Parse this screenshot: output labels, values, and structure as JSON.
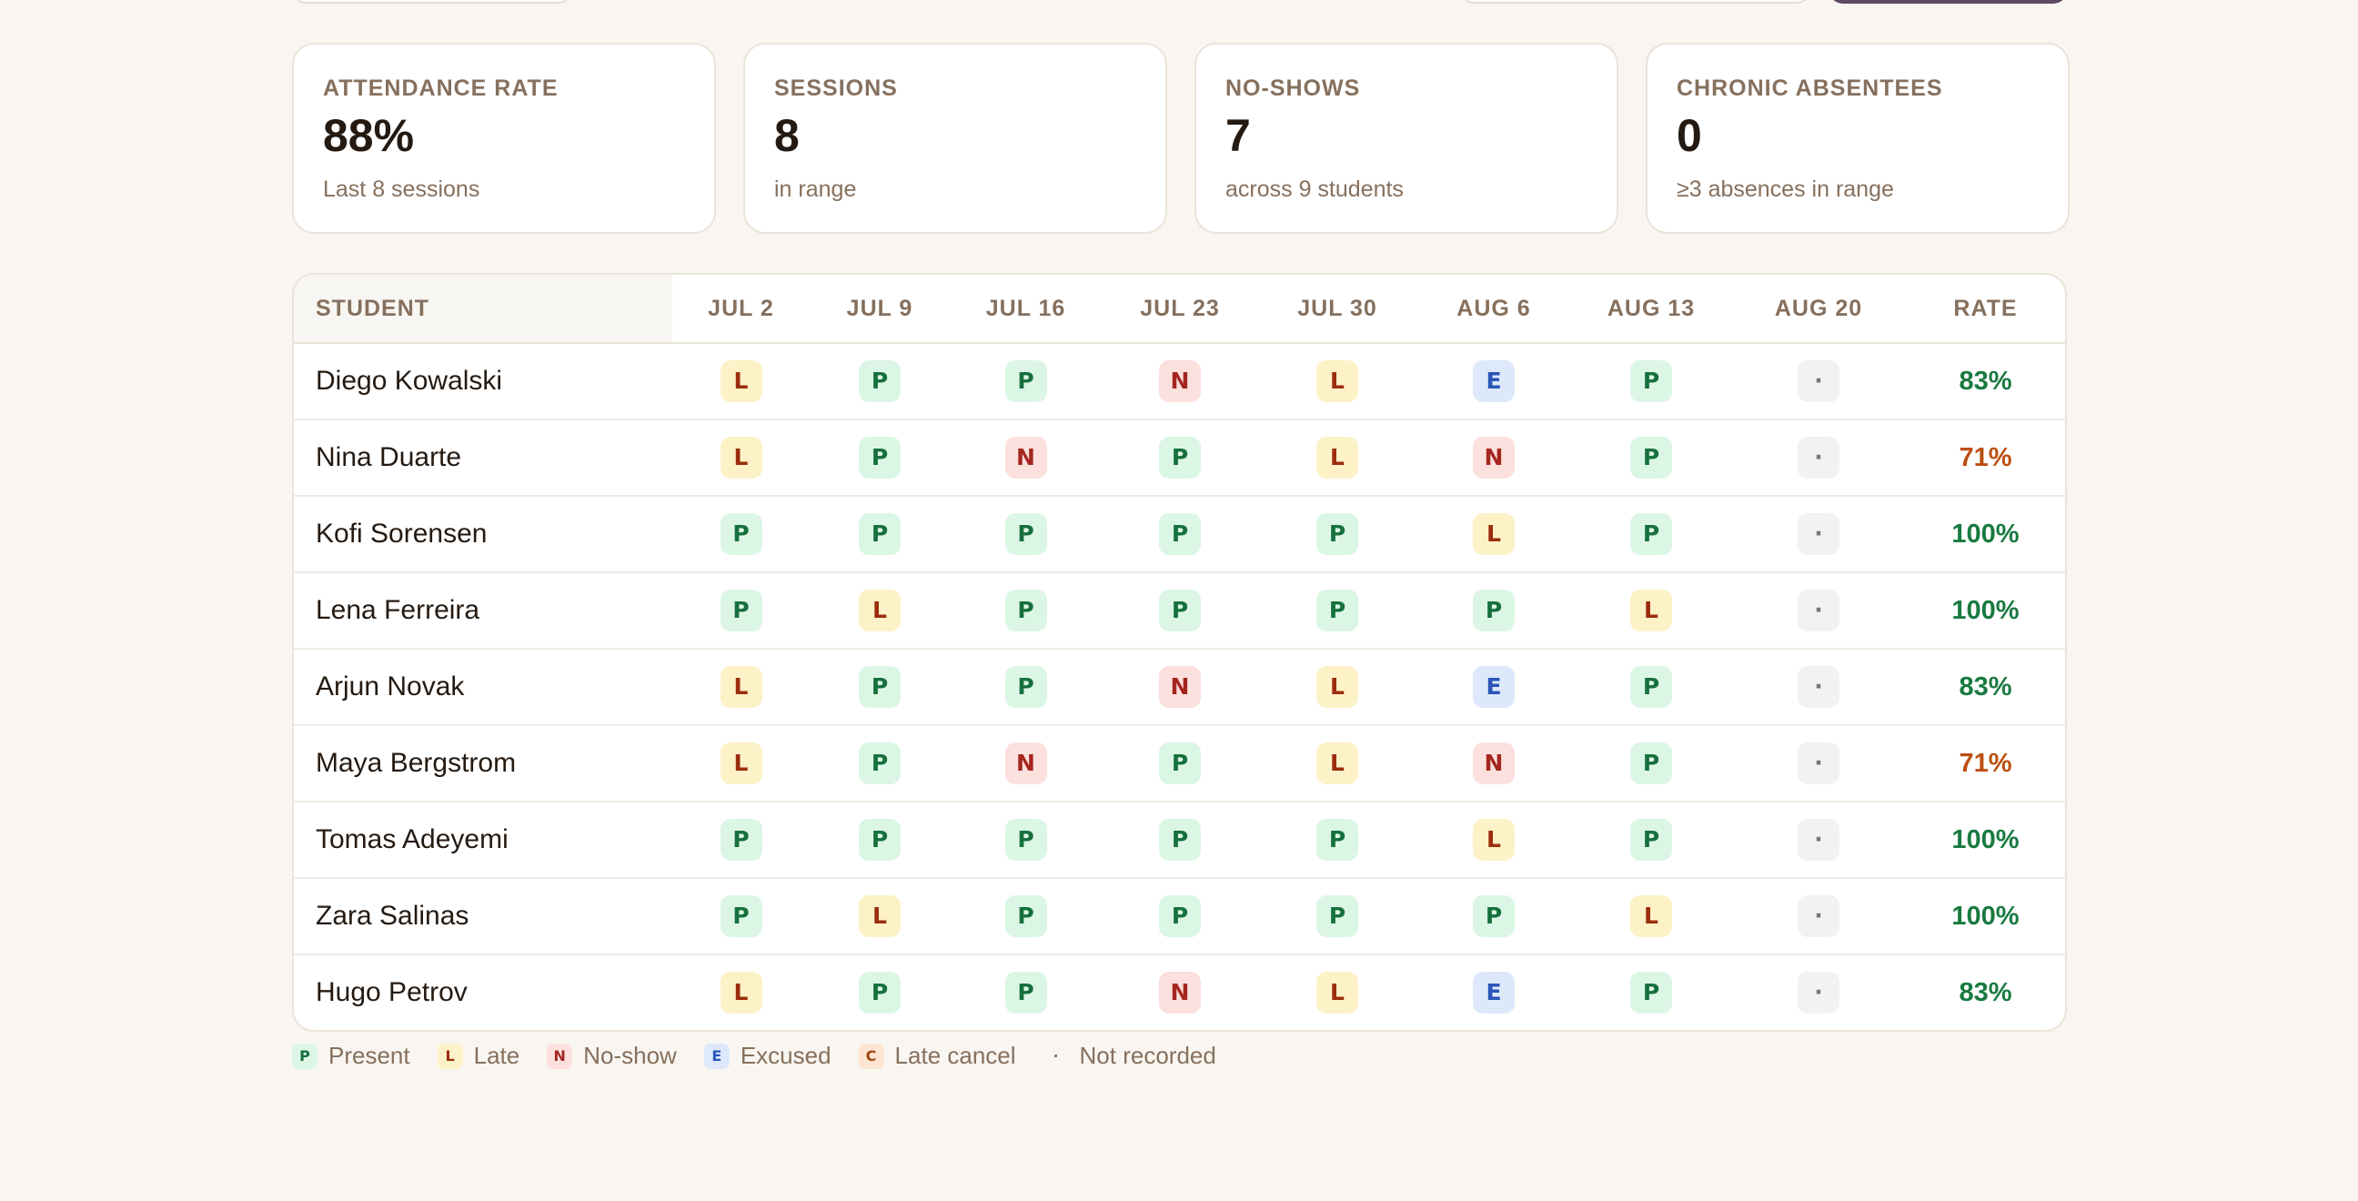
{
  "stats": [
    {
      "label": "Attendance rate",
      "value": "88%",
      "sub": "Last 8 sessions"
    },
    {
      "label": "Sessions",
      "value": "8",
      "sub": "in range"
    },
    {
      "label": "No-shows",
      "value": "7",
      "sub": "across 9 students"
    },
    {
      "label": "Chronic absentees",
      "value": "0",
      "sub": "≥3 absences in range"
    }
  ],
  "table": {
    "headers": [
      "Student",
      "Jul 2",
      "Jul 9",
      "Jul 16",
      "Jul 23",
      "Jul 30",
      "Aug 6",
      "Aug 13",
      "Aug 20",
      "Rate"
    ],
    "rows": [
      {
        "name": "Diego Kowalski",
        "marks": [
          "L",
          "P",
          "P",
          "N",
          "L",
          "E",
          "P",
          "·"
        ],
        "rate": "83%",
        "status": "good"
      },
      {
        "name": "Nina Duarte",
        "marks": [
          "L",
          "P",
          "N",
          "P",
          "L",
          "N",
          "P",
          "·"
        ],
        "rate": "71%",
        "status": "warn"
      },
      {
        "name": "Kofi Sorensen",
        "marks": [
          "P",
          "P",
          "P",
          "P",
          "P",
          "L",
          "P",
          "·"
        ],
        "rate": "100%",
        "status": "good"
      },
      {
        "name": "Lena Ferreira",
        "marks": [
          "P",
          "L",
          "P",
          "P",
          "P",
          "P",
          "L",
          "·"
        ],
        "rate": "100%",
        "status": "good"
      },
      {
        "name": "Arjun Novak",
        "marks": [
          "L",
          "P",
          "P",
          "N",
          "L",
          "E",
          "P",
          "·"
        ],
        "rate": "83%",
        "status": "good"
      },
      {
        "name": "Maya Bergstrom",
        "marks": [
          "L",
          "P",
          "N",
          "P",
          "L",
          "N",
          "P",
          "·"
        ],
        "rate": "71%",
        "status": "warn"
      },
      {
        "name": "Tomas Adeyemi",
        "marks": [
          "P",
          "P",
          "P",
          "P",
          "P",
          "L",
          "P",
          "·"
        ],
        "rate": "100%",
        "status": "good"
      },
      {
        "name": "Zara Salinas",
        "marks": [
          "P",
          "L",
          "P",
          "P",
          "P",
          "P",
          "L",
          "·"
        ],
        "rate": "100%",
        "status": "good"
      },
      {
        "name": "Hugo Petrov",
        "marks": [
          "L",
          "P",
          "P",
          "N",
          "L",
          "E",
          "P",
          "·"
        ],
        "rate": "83%",
        "status": "good"
      }
    ]
  },
  "legend": [
    {
      "code": "P",
      "label": "Present"
    },
    {
      "code": "L",
      "label": "Late"
    },
    {
      "code": "N",
      "label": "No-show"
    },
    {
      "code": "E",
      "label": "Excused"
    },
    {
      "code": "C",
      "label": "Late cancel"
    },
    {
      "code": "·",
      "label": "Not recorded"
    }
  ],
  "colors": {
    "present": "#16703d",
    "late": "#9b2d0d",
    "no_show": "#a4261f",
    "excused": "#2a56b8",
    "late_cancel": "#a1460f",
    "rate_good": "#197a40",
    "rate_warn": "#bb4f10",
    "primary_button": "#5e4a63"
  }
}
